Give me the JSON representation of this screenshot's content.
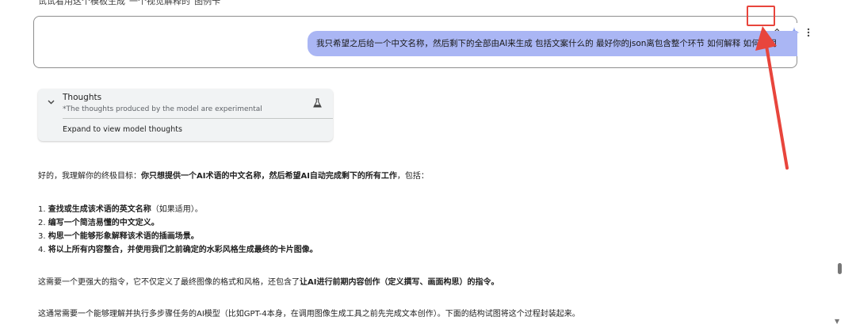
{
  "top_cut_text": "试试看用这个模板生成\"一个视觉解释的\"图例卡",
  "prompt": {
    "user_message": "我只希望之后给一个中文名称，然后剩下的全部由AI来生成 包括文案什么的 最好你的json离包含整个环节 如何解释 如何说明",
    "tools": {
      "edit_icon": "pencil-icon",
      "spark_icon": "sparkle-icon",
      "more_icon": "more-vert-icon"
    }
  },
  "thoughts": {
    "title": "Thoughts",
    "subtitle": "*The thoughts produced by the model are experimental",
    "expand_label": "Expand to view model thoughts",
    "icon": "flask-icon"
  },
  "response": {
    "intro_prefix": "好的，我理解你的终极目标：",
    "intro_bold": "你只想提供一个AI术语的中文名称，然后希望AI自动完成剩下的所有工作",
    "intro_suffix": "，包括：",
    "items": [
      {
        "num": "1.",
        "bold": "查找或生成该术语的英文名称",
        "rest": "（如果适用）。"
      },
      {
        "num": "2.",
        "bold": "编写一个简洁易懂的中文定义。",
        "rest": ""
      },
      {
        "num": "3.",
        "bold": "构思一个能够形象解释该术语的插画场景。",
        "rest": ""
      },
      {
        "num": "4.",
        "bold": "将以上所有内容整合，并使用我们之前确定的水彩风格生成最终的卡片图像。",
        "rest": ""
      }
    ],
    "para2_prefix": "这需要一个更强大的指令，它不仅定义了最终图像的格式和风格，还包含了",
    "para2_bold": "让AI进行前期内容创作（定义撰写、画面构思）的指令。",
    "para3": "这通常需要一个能够理解并执行多步骤任务的AI模型（比如GPT-4本身，在调用图像生成工具之前先完成文本创作）。下面的结构试图将这个过程封装起来。"
  },
  "colors": {
    "user_bubble": "#aab6f4",
    "highlight": "#e8453c",
    "spark": "#8aa0ee"
  }
}
